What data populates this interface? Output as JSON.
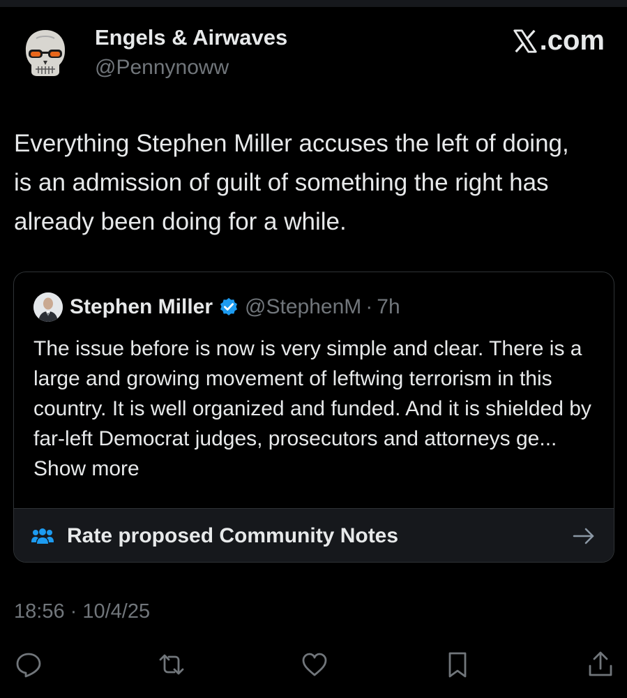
{
  "author": {
    "name": "Engels & Airwaves",
    "handle": "@Pennynoww",
    "avatar_icon": "skull-with-orange-sunglasses"
  },
  "brand": {
    "label": ".com",
    "logo_icon": "x-logo"
  },
  "post": {
    "text": "Everything Stephen Miller accuses the left of doing, is an admission of guilt of something the right has already been doing for a while."
  },
  "quote": {
    "name": "Stephen Miller",
    "verified_icon": "verified-badge",
    "handle": "@StephenM",
    "separator": "·",
    "time": "7h",
    "text": "The issue before is now is very simple and clear. There is a large and growing movement of leftwing terrorism in this country. It is well organized and funded. And it is shielded by far-left Democrat judges, prosecutors and attorneys ge...",
    "show_more": "Show more"
  },
  "community_notes": {
    "label": "Rate proposed Community Notes",
    "icon": "people-icon",
    "arrow_icon": "arrow-right-icon"
  },
  "timestamp": "18:56 · 10/4/25",
  "actions": [
    "reply-icon",
    "repost-icon",
    "like-icon",
    "bookmark-icon",
    "share-icon"
  ],
  "colors": {
    "background": "#000000",
    "text": "#e7e9ea",
    "muted": "#71767b",
    "accent": "#1d9bf0",
    "card_border": "#2f3336"
  }
}
